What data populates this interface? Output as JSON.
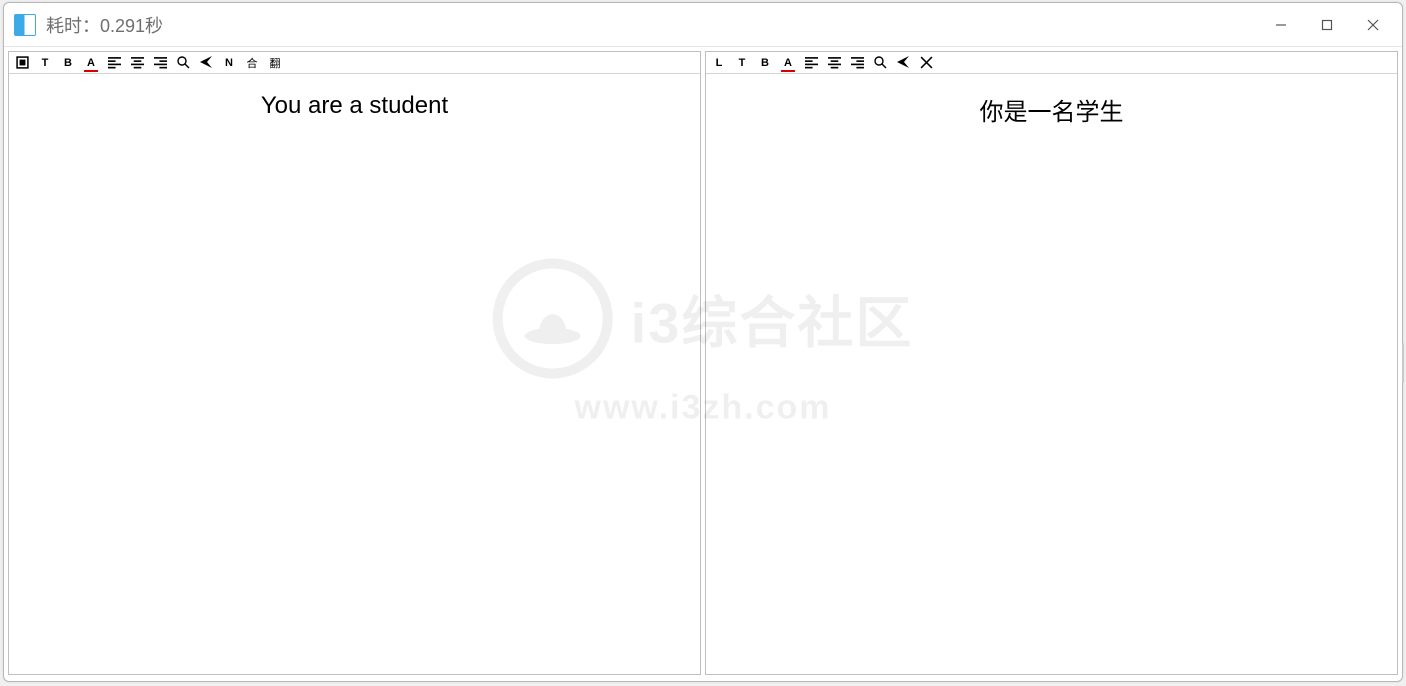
{
  "window": {
    "title": "耗时：0.291秒"
  },
  "left_pane": {
    "toolbar": {
      "btn1": "▣",
      "btn_t": "T",
      "btn_b": "B",
      "btn_a": "A",
      "btn_n": "N",
      "btn_he": "合",
      "btn_fan": "翻"
    },
    "content": "You are a student"
  },
  "right_pane": {
    "toolbar": {
      "btn_l": "L",
      "btn_t": "T",
      "btn_b": "B",
      "btn_a": "A"
    },
    "content": "你是一名学生"
  },
  "watermark": {
    "text_main": "i3综合社区",
    "text_url": "www.i3zh.com"
  }
}
